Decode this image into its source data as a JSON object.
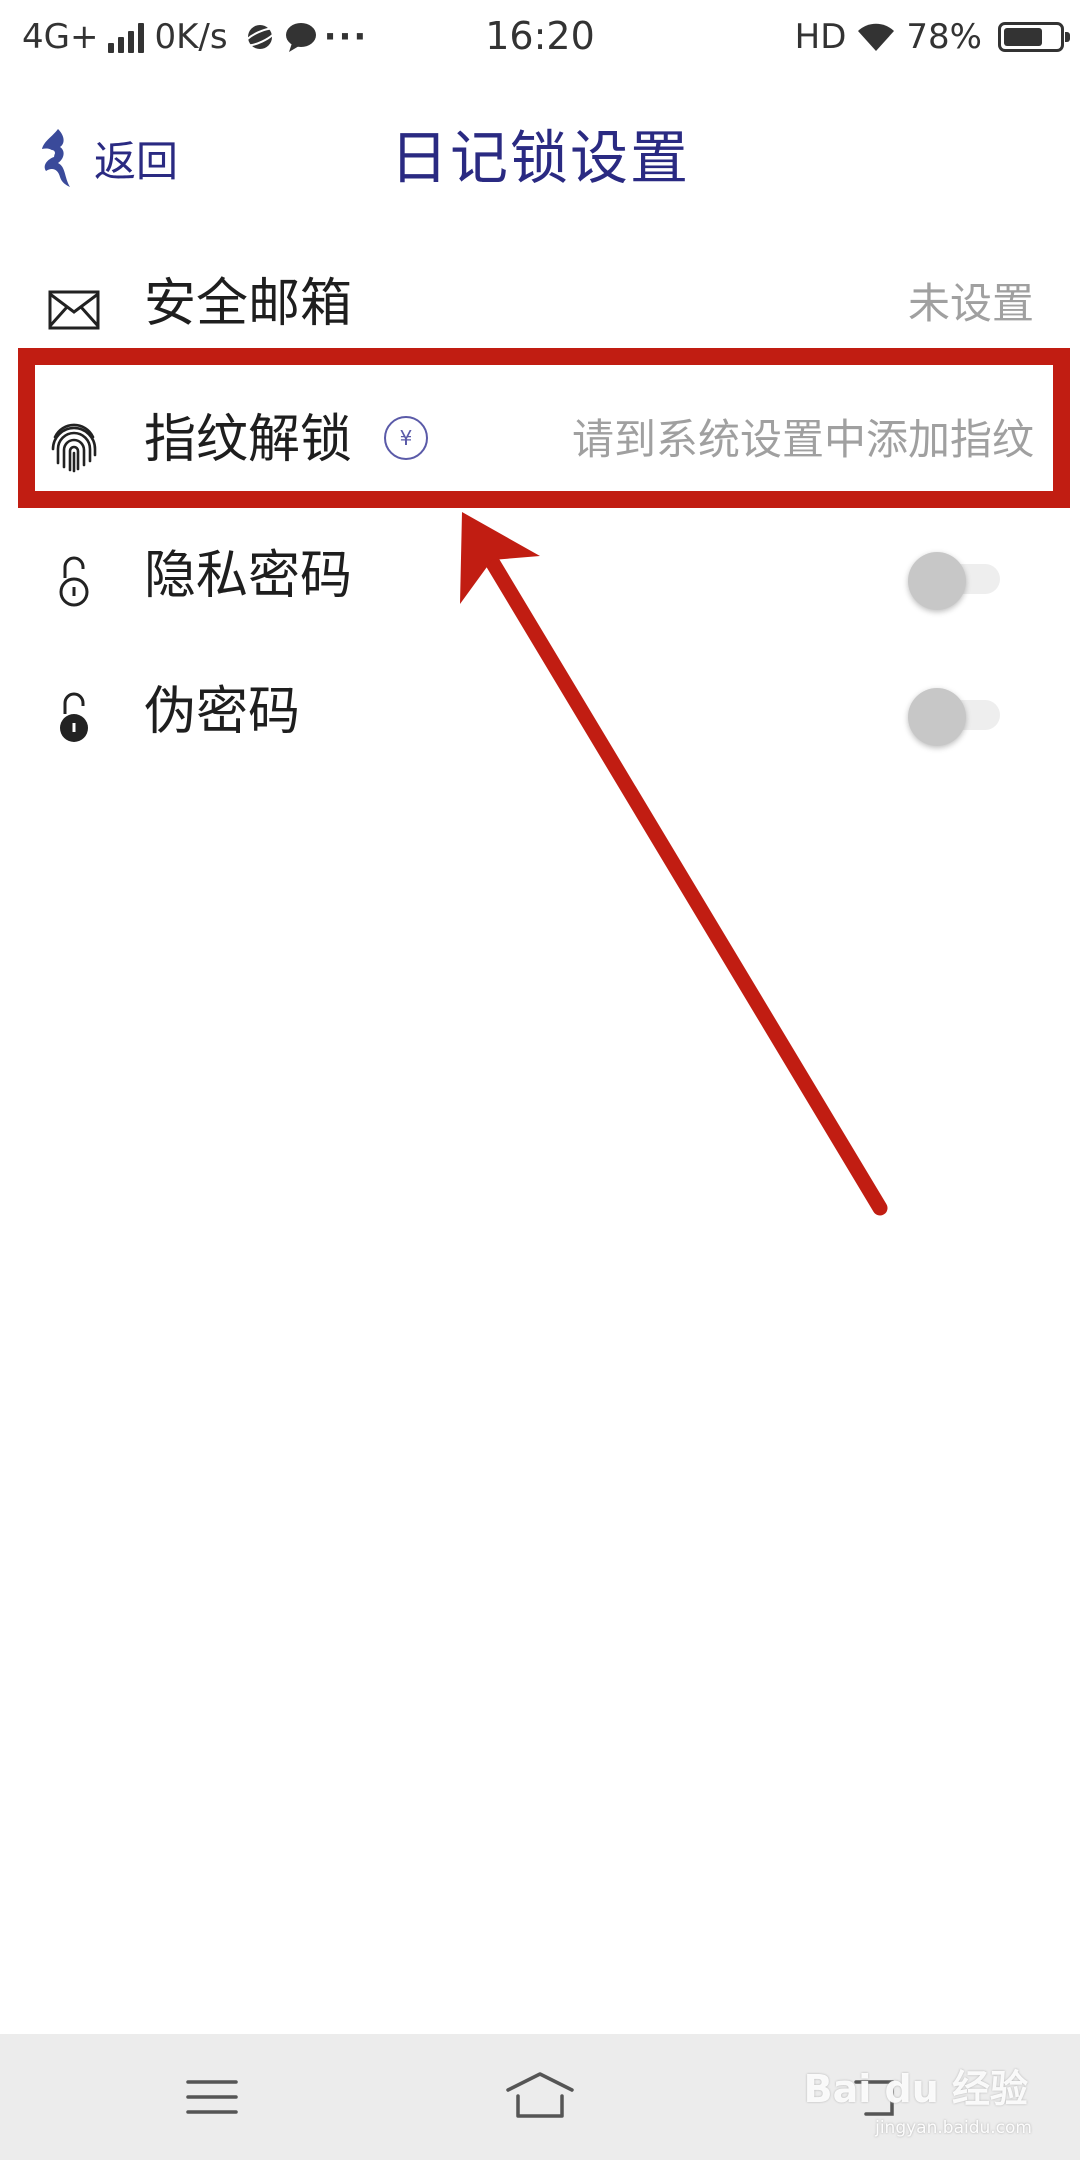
{
  "status_bar": {
    "network": "4G+",
    "speed": "0K/s",
    "more": "···",
    "time": "16:20",
    "hd": "HD",
    "battery": "78%",
    "battery_level": 0.78
  },
  "header": {
    "back_label": "返回",
    "title": "日记锁设置"
  },
  "settings": {
    "items": [
      {
        "label": "安全邮箱",
        "value": "未设置",
        "icon": "envelope-icon"
      },
      {
        "label": "指纹解锁",
        "value": "请到系统设置中添加指纹",
        "icon": "fingerprint-icon",
        "badge": "¥"
      },
      {
        "label": "隐私密码",
        "toggle": false,
        "icon": "lock-open-icon"
      },
      {
        "label": "伪密码",
        "toggle": false,
        "icon": "lock-filled-icon"
      }
    ]
  },
  "watermark": {
    "brand": "Bai du 经验",
    "url": "jingyan.baidu.com"
  },
  "colors": {
    "title": "#2a2a82",
    "annotation": "#c11d12",
    "secondary_text": "#a0a0a0",
    "navbar": "#ececec"
  }
}
